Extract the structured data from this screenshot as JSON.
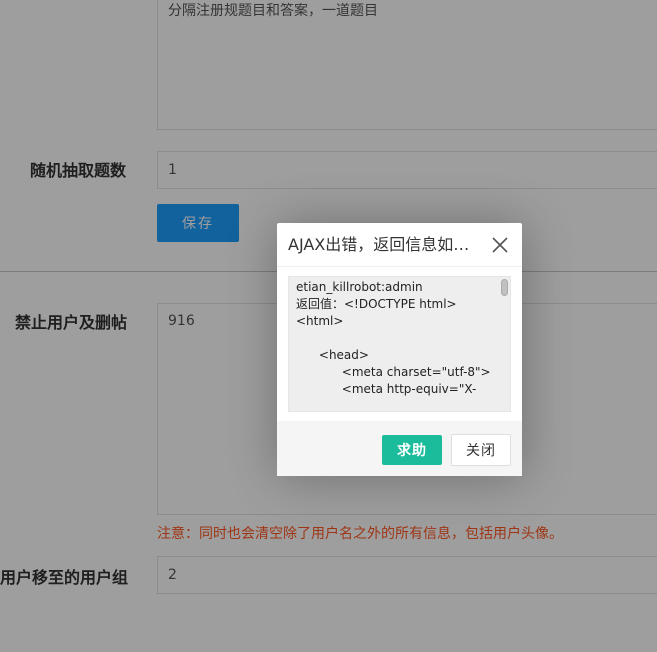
{
  "form": {
    "top_textarea_text": "分隔注册规题目和答案，一道题目",
    "random_count_label": "随机抽取题数",
    "random_count_value": "1",
    "save_label": "保存",
    "ban_label": "禁止用户及删帖",
    "ban_value": "916",
    "note": "注意：同时也会清空除了用户名之外的所有信息，包括用户头像。",
    "move_group_label": "用户移至的用户组",
    "move_group_value": "2"
  },
  "dialog": {
    "title": "AJAX出错，返回信息如下：",
    "message": "etian_killrobot:admin\n返回值：<!DOCTYPE html>\n<html>\n\n      <head>\n            <meta charset=\"utf-8\">\n            <meta http-equiv=\"X-",
    "help_label": "求助",
    "close_label": "关闭"
  },
  "colors": {
    "primary": "#1e9fff",
    "help": "#1abc9c",
    "warning": "#ff5722"
  },
  "icons": {
    "close": "close-icon"
  }
}
